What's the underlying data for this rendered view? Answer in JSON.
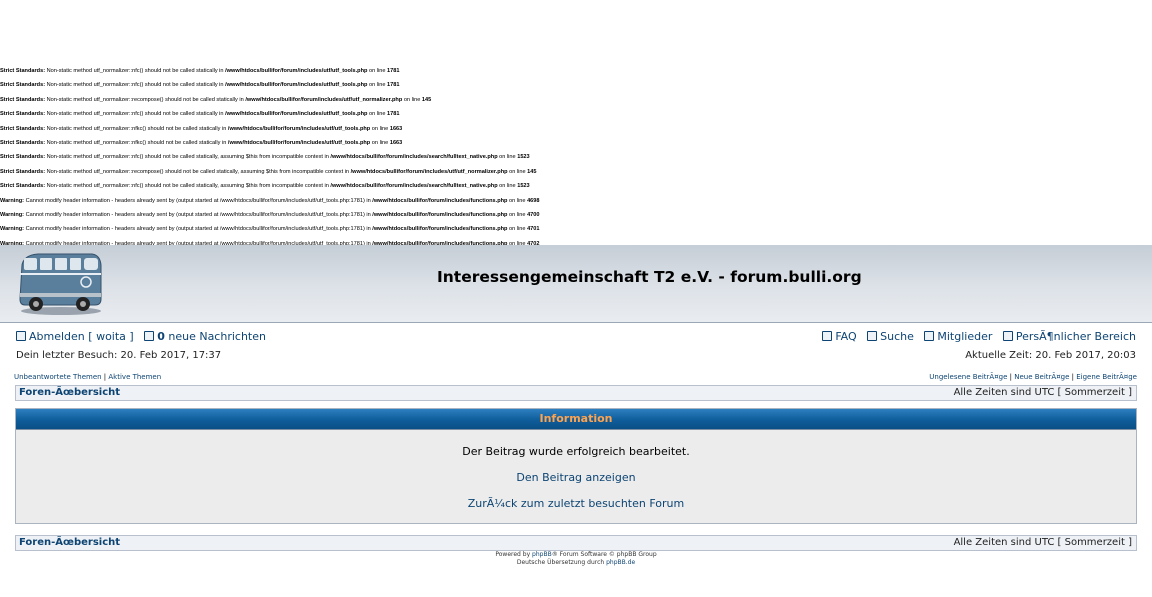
{
  "errors": [
    {
      "label": "Strict Standards:",
      "pre": " Non-static method utf_normalizer::nfc() should not be called statically in ",
      "file": "/www/htdocs/bullifor/forum/includes/utf/utf_tools.php",
      "mid": " on line ",
      "line": "1781"
    },
    {
      "label": "Strict Standards:",
      "pre": " Non-static method utf_normalizer::nfc() should not be called statically in ",
      "file": "/www/htdocs/bullifor/forum/includes/utf/utf_tools.php",
      "mid": " on line ",
      "line": "1781"
    },
    {
      "label": "Strict Standards:",
      "pre": " Non-static method utf_normalizer::recompose() should not be called statically in ",
      "file": "/www/htdocs/bullifor/forum/includes/utf/utf_normalizer.php",
      "mid": " on line ",
      "line": "145"
    },
    {
      "label": "Strict Standards:",
      "pre": " Non-static method utf_normalizer::nfc() should not be called statically in ",
      "file": "/www/htdocs/bullifor/forum/includes/utf/utf_tools.php",
      "mid": " on line ",
      "line": "1781"
    },
    {
      "label": "Strict Standards:",
      "pre": " Non-static method utf_normalizer::nfkc() should not be called statically in ",
      "file": "/www/htdocs/bullifor/forum/includes/utf/utf_tools.php",
      "mid": " on line ",
      "line": "1663"
    },
    {
      "label": "Strict Standards:",
      "pre": " Non-static method utf_normalizer::nfkc() should not be called statically in ",
      "file": "/www/htdocs/bullifor/forum/includes/utf/utf_tools.php",
      "mid": " on line ",
      "line": "1663"
    },
    {
      "label": "Strict Standards:",
      "pre": " Non-static method utf_normalizer::nfc() should not be called statically, assuming $this from incompatible context in ",
      "file": "/www/htdocs/bullifor/forum/includes/search/fulltext_native.php",
      "mid": " on line ",
      "line": "1523"
    },
    {
      "label": "Strict Standards:",
      "pre": " Non-static method utf_normalizer::recompose() should not be called statically, assuming $this from incompatible context in ",
      "file": "/www/htdocs/bullifor/forum/includes/utf/utf_normalizer.php",
      "mid": " on line ",
      "line": "145"
    },
    {
      "label": "Strict Standards:",
      "pre": " Non-static method utf_normalizer::nfc() should not be called statically, assuming $this from incompatible context in ",
      "file": "/www/htdocs/bullifor/forum/includes/search/fulltext_native.php",
      "mid": " on line ",
      "line": "1523"
    },
    {
      "label": "Warning:",
      "pre": " Cannot modify header information - headers already sent by (output started at /www/htdocs/bullifor/forum/includes/utf/utf_tools.php:1781) in ",
      "file": "/www/htdocs/bullifor/forum/includes/functions.php",
      "mid": " on line ",
      "line": "4698"
    },
    {
      "label": "Warning:",
      "pre": " Cannot modify header information - headers already sent by (output started at /www/htdocs/bullifor/forum/includes/utf/utf_tools.php:1781) in ",
      "file": "/www/htdocs/bullifor/forum/includes/functions.php",
      "mid": " on line ",
      "line": "4700"
    },
    {
      "label": "Warning:",
      "pre": " Cannot modify header information - headers already sent by (output started at /www/htdocs/bullifor/forum/includes/utf/utf_tools.php:1781) in ",
      "file": "/www/htdocs/bullifor/forum/includes/functions.php",
      "mid": " on line ",
      "line": "4701"
    },
    {
      "label": "Warning:",
      "pre": " Cannot modify header information - headers already sent by (output started at /www/htdocs/bullifor/forum/includes/utf/utf_tools.php:1781) in ",
      "file": "/www/htdocs/bullifor/forum/includes/functions.php",
      "mid": " on line ",
      "line": "4702"
    }
  ],
  "header": {
    "title": "Interessengemeinschaft T2 e.V. - forum.bulli.org",
    "logo_alt": "VW T2 bus logo"
  },
  "nav": {
    "logout": "Abmelden",
    "user": "[ woita ]",
    "new_msg_count": "0",
    "new_msg_label": "neue Nachrichten",
    "faq": "FAQ",
    "search": "Suche",
    "members": "Mitglieder",
    "profile": "PersÃ¶nlicher Bereich",
    "last_visit": "Dein letzter Besuch: 20. Feb 2017, 17:37",
    "current_time": "Aktuelle Zeit: 20. Feb 2017, 20:03"
  },
  "small_links": {
    "unanswered": "Unbeantwortete Themen",
    "active": "Aktive Themen",
    "unread": "Ungelesene BeitrÃ¤ge",
    "new_posts": "Neue BeitrÃ¤ge",
    "own_posts": "Eigene BeitrÃ¤ge",
    "sep": " | "
  },
  "breadcrumb": {
    "label": "Foren-Ãœbersicht",
    "timezone": "Alle Zeiten sind UTC [ Sommerzeit ]"
  },
  "info": {
    "title": "Information",
    "message": "Der Beitrag wurde erfolgreich bearbeitet.",
    "view_post": "Den Beitrag anzeigen",
    "back": "ZurÃ¼ck zum zuletzt besuchten Forum"
  },
  "footer": {
    "powered_pre": "Powered by ",
    "phpbb": "phpBB",
    "powered_post": "® Forum Software © phpBB Group",
    "translation_pre": "Deutsche Übersetzung durch ",
    "translation_link": "phpBB.de"
  },
  "colors": {
    "link": "#0d4473",
    "info_title": "#ffa34f",
    "info_header": "#0f5d9b"
  }
}
